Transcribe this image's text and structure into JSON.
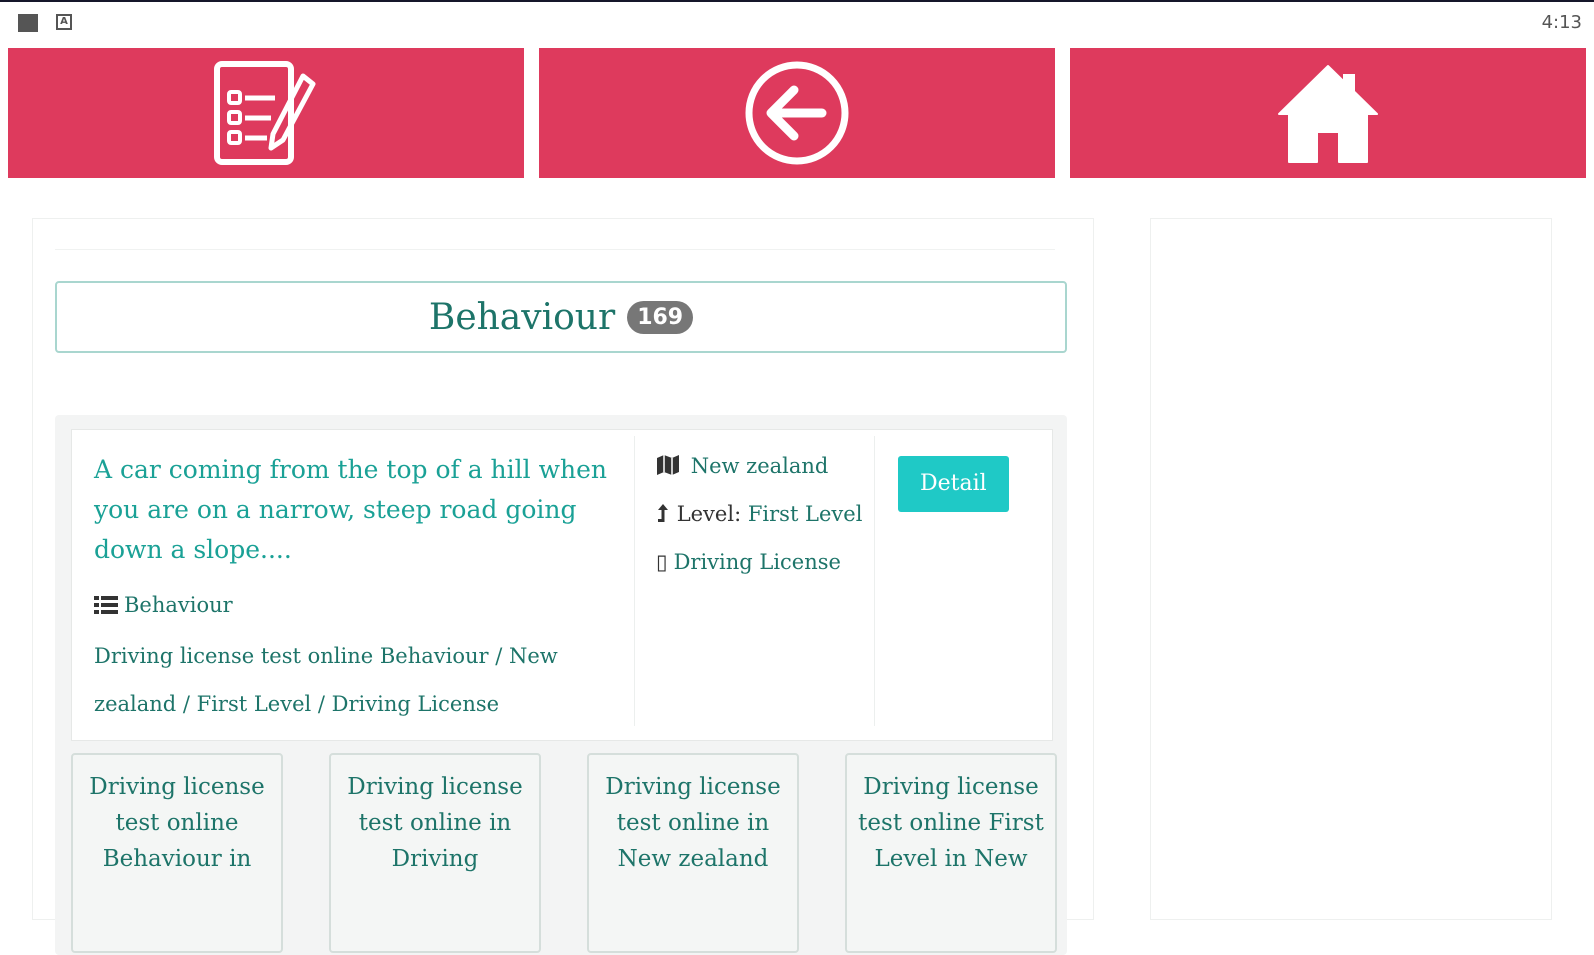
{
  "status_bar": {
    "time": "4:13",
    "icons": [
      "square-icon",
      "a-icon"
    ]
  },
  "nav": {
    "buttons": [
      {
        "icon": "checklist-edit-icon"
      },
      {
        "icon": "back-arrow-icon"
      },
      {
        "icon": "home-icon"
      }
    ],
    "color": "#de3a5d"
  },
  "category": {
    "title": "Behaviour",
    "count": "169"
  },
  "question": {
    "text": "A car coming from the top of a hill when you are on a narrow, steep road going down a slope....",
    "category": "Behaviour",
    "breadcrumb": "Driving license test online Behaviour / New zealand / First Level / Driving License",
    "country": "New zealand",
    "level_label": "Level:",
    "level_value": "First Level",
    "license": "Driving License",
    "detail_label": "Detail"
  },
  "tiles": [
    "Driving license test online Behaviour in",
    "Driving license test online in Driving",
    "Driving license test online in New zealand",
    "Driving license test online First Level in New"
  ],
  "colors": {
    "accent": "#de3a5d",
    "teal_text": "#1aa196",
    "dark_teal": "#1d7469",
    "button": "#1fc9c6"
  }
}
